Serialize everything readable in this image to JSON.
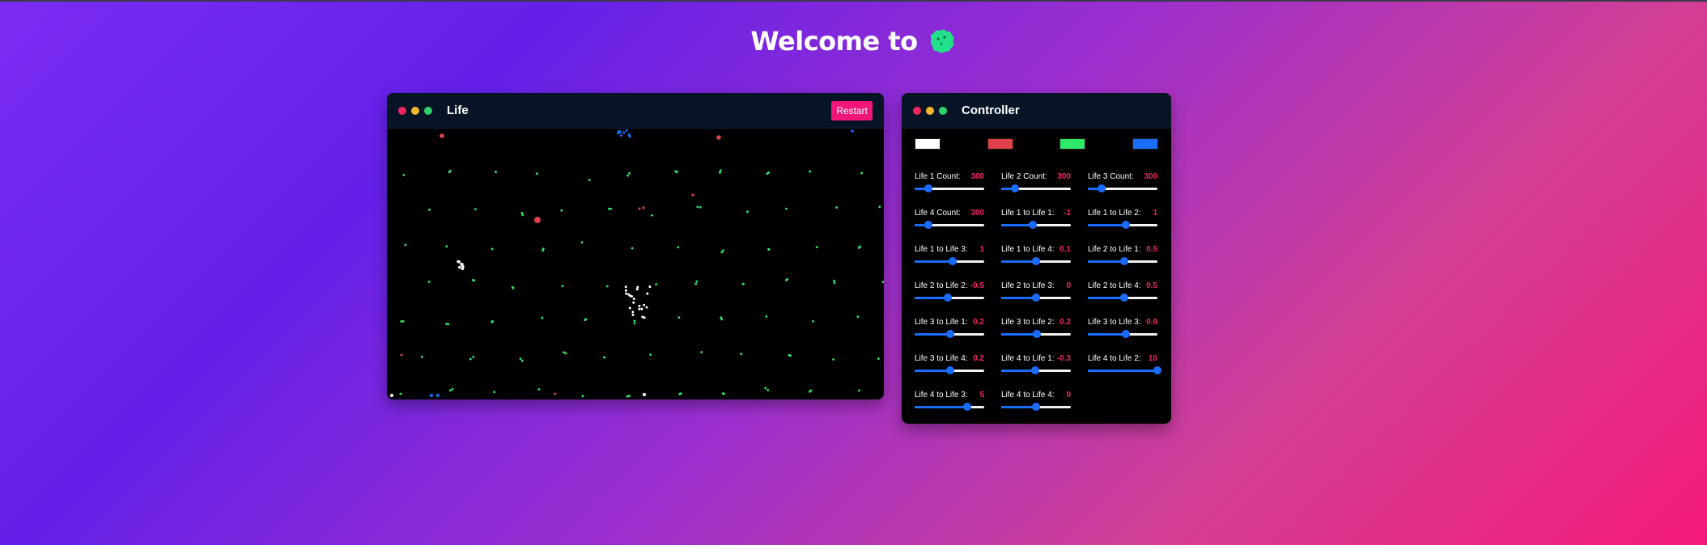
{
  "page": {
    "title": "Welcome to",
    "logo_icon": "green-blob-icon"
  },
  "life_window": {
    "title": "Life",
    "restart_label": "Restart"
  },
  "controller_window": {
    "title": "Controller",
    "swatches": [
      {
        "name": "life-1-color",
        "color": "#ffffff"
      },
      {
        "name": "life-2-color",
        "color": "#e0404a"
      },
      {
        "name": "life-3-color",
        "color": "#2ee86a"
      },
      {
        "name": "life-4-color",
        "color": "#1a6cff"
      }
    ],
    "controls": [
      {
        "label": "Life 1 Count:",
        "value": "300",
        "level": 0.2
      },
      {
        "label": "Life 2 Count:",
        "value": "300",
        "level": 0.2
      },
      {
        "label": "Life 3 Count:",
        "value": "300",
        "level": 0.2
      },
      {
        "label": "Life 4 Count:",
        "value": "300",
        "level": 0.2
      },
      {
        "label": "Life 1 to Life 1:",
        "value": "-1",
        "level": 0.45
      },
      {
        "label": "Life 1 to Life 2:",
        "value": "1",
        "level": 0.55
      },
      {
        "label": "Life 1 to Life 3:",
        "value": "1",
        "level": 0.55
      },
      {
        "label": "Life 1 to Life 4:",
        "value": "0.1",
        "level": 0.5
      },
      {
        "label": "Life 2 to Life 1:",
        "value": "0.5",
        "level": 0.52
      },
      {
        "label": "Life 2 to Life 2:",
        "value": "-0.5",
        "level": 0.48
      },
      {
        "label": "Life 2 to Life 3:",
        "value": "0",
        "level": 0.5
      },
      {
        "label": "Life 2 to Life 4:",
        "value": "0.5",
        "level": 0.52
      },
      {
        "label": "Life 3 to Life 1:",
        "value": "0.2",
        "level": 0.51
      },
      {
        "label": "Life 3 to Life 2:",
        "value": "0.2",
        "level": 0.51
      },
      {
        "label": "Life 3 to Life 3:",
        "value": "0.9",
        "level": 0.55
      },
      {
        "label": "Life 3 to Life 4:",
        "value": "0.2",
        "level": 0.51
      },
      {
        "label": "Life 4 to Life 1:",
        "value": "-0.3",
        "level": 0.49
      },
      {
        "label": "Life 4 to Life 2:",
        "value": "10",
        "level": 1.0
      },
      {
        "label": "Life 4 to Life 3:",
        "value": "5",
        "level": 0.75
      },
      {
        "label": "Life 4 to Life 4:",
        "value": "0",
        "level": 0.5
      }
    ]
  }
}
